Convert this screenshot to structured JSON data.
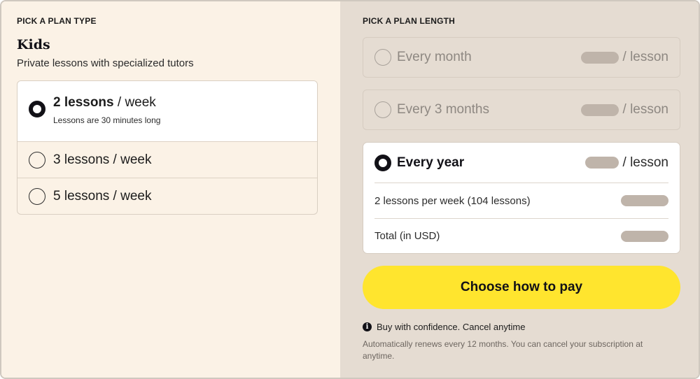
{
  "plan_type": {
    "section_label": "PICK A PLAN TYPE",
    "title": "Kids",
    "subtitle": "Private lessons with specialized tutors",
    "options": [
      {
        "bold": "2 lessons",
        "rest": " / week",
        "note": "Lessons are 30 minutes long",
        "selected": true
      },
      {
        "label": "3 lessons / week",
        "selected": false
      },
      {
        "label": "5 lessons / week",
        "selected": false
      }
    ]
  },
  "plan_length": {
    "section_label": "PICK A PLAN LENGTH",
    "options": [
      {
        "label": "Every month",
        "per": "/ lesson",
        "selected": false
      },
      {
        "label": "Every 3 months",
        "per": "/ lesson",
        "selected": false
      },
      {
        "label": "Every year",
        "per": "/ lesson",
        "selected": true
      }
    ],
    "details": [
      {
        "label": "2 lessons per week (104 lessons)"
      },
      {
        "label": "Total (in USD)"
      }
    ]
  },
  "pay_button_label": "Choose how to pay",
  "confidence": {
    "icon": "info-icon",
    "text": "Buy with confidence. Cancel anytime",
    "note": "Automatically renews every 12 months. You can cancel your subscription at anytime."
  },
  "colors": {
    "left_bg": "#fbf2e6",
    "right_bg": "#e5dcd2",
    "accent_yellow": "#ffe52e",
    "price_placeholder": "#bfb4aa"
  }
}
